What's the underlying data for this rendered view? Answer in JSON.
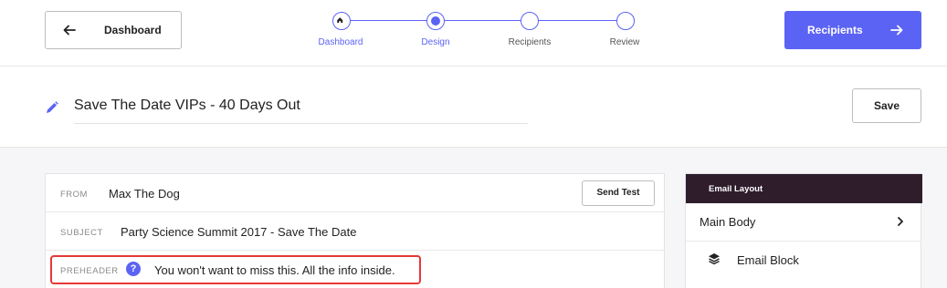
{
  "nav": {
    "back_label": "Dashboard",
    "next_label": "Recipients"
  },
  "stepper": {
    "steps": [
      {
        "label": "Dashboard",
        "state": "done"
      },
      {
        "label": "Design",
        "state": "current"
      },
      {
        "label": "Recipients",
        "state": "todo"
      },
      {
        "label": "Review",
        "state": "todo"
      }
    ]
  },
  "campaign": {
    "title": "Save The Date VIPs - 40 Days Out",
    "save_label": "Save"
  },
  "form": {
    "from_label": "FROM",
    "from_value": "Max The Dog",
    "send_test_label": "Send Test",
    "subject_label": "SUBJECT",
    "subject_value": "Party Science Summit 2017 - Save The Date",
    "preheader_label": "PREHEADER",
    "help_glyph": "?",
    "preheader_value": "You won't want to miss this. All the info inside."
  },
  "side_panel": {
    "header": "Email Layout",
    "section_label": "Main Body",
    "block_label": "Email Block"
  },
  "colors": {
    "accent": "#5b63f5",
    "panel_header": "#2f1d2c",
    "highlight": "#e53935"
  },
  "icons": {
    "back": "arrow-left-icon",
    "next": "arrow-right-icon",
    "home": "home-icon",
    "edit": "pencil-icon",
    "help": "question-icon",
    "chevron": "chevron-right-icon",
    "layers": "layers-icon"
  }
}
